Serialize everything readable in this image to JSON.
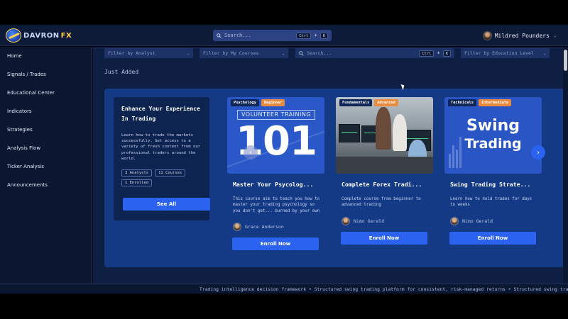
{
  "brand": {
    "name_part1": "DAVRON",
    "name_part2": "FX"
  },
  "topbar": {
    "search_placeholder": "Search...",
    "shortcut_key1": "Ctrl",
    "shortcut_plus": "+",
    "shortcut_key2": "K",
    "user_name": "Mildred Pounders"
  },
  "sidebar": {
    "items": [
      {
        "label": "Home"
      },
      {
        "label": "Signals / Trades"
      },
      {
        "label": "Educational Center"
      },
      {
        "label": "Indicators"
      },
      {
        "label": "Strategies"
      },
      {
        "label": "Analysis Flow"
      },
      {
        "label": "Ticker Analysis"
      },
      {
        "label": "Announcements"
      }
    ]
  },
  "filters": {
    "analyst": "Filter by Analyst",
    "courses": "Filter by My Courses",
    "search": "Search...",
    "search_key1": "Ctrl",
    "search_plus": "+",
    "search_key2": "K",
    "education": "Filter by Education Level"
  },
  "section": {
    "title": "Just Added"
  },
  "intro": {
    "title": "Enhance Your Experience In Trading",
    "body": "Learn how to trade the markets successfully. Get access to a variety of fresh content from our professional traders around the world.",
    "chip_analysts": "3 Analysts",
    "chip_courses": "11 Courses",
    "chip_enrolled": "1 Enrolled",
    "button": "See All"
  },
  "courses": [
    {
      "category": "Psychology",
      "level": "Beginner",
      "image_text_top": "VOLUNTEER TRAINING",
      "image_text_main": "101",
      "title": "Master Your Psycolog...",
      "description": "This course aim to teach you how to master your trading psychology so you don't get... burned by your own emotions",
      "author": "Grace Anderson",
      "button": "Enroll Now"
    },
    {
      "category": "Fundamentals",
      "level": "Advanced",
      "title": "Complete Forex Tradi...",
      "description": "Complete course from beginner to advanced trading",
      "author": "Nimo Gerald",
      "button": "Enroll Now"
    },
    {
      "category": "Technicals",
      "level": "Intermediate",
      "image_text_line1": "Swing",
      "image_text_line2": "Trading",
      "title": "Swing Trading Strate...",
      "description": "Learn how to hold trades for days to weeks",
      "author": "Nimo Gerald",
      "button": "Enroll Now"
    }
  ],
  "footer": {
    "ticker": "Trading intelligence decision framework • Structured swing trading platform for consistent, risk-managed returns • Structured swing trading platform"
  },
  "colors": {
    "accent": "#2b62f0",
    "level_badge": "#e98a3c",
    "panel": "#143a86",
    "background": "#0f1f44"
  },
  "icons": [
    "search-icon",
    "chevron-down-icon",
    "chevron-left-icon",
    "chevron-right-icon"
  ]
}
